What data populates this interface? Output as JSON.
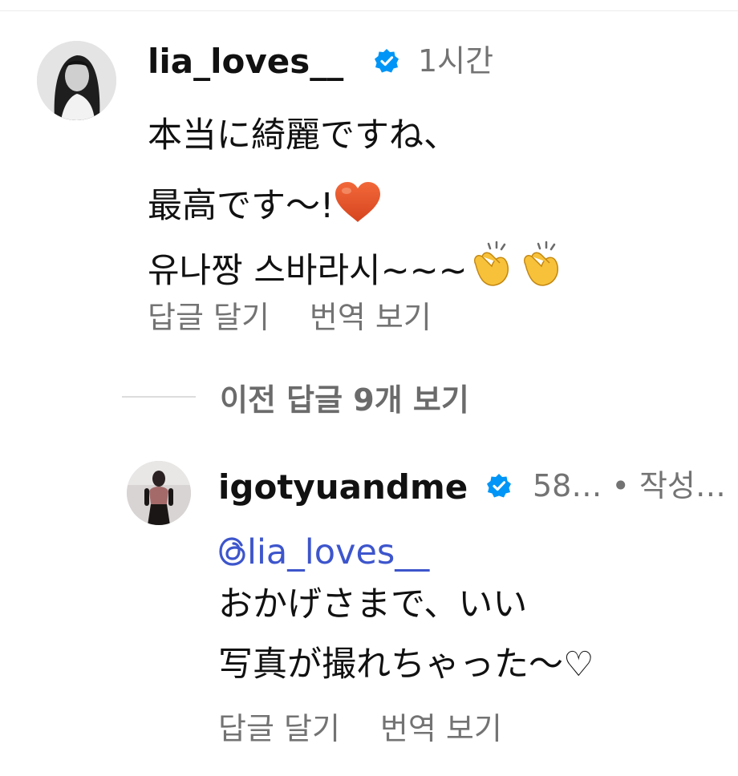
{
  "comments": [
    {
      "username": "lia_loves__",
      "verified": true,
      "time": "1시간",
      "lines": [
        "本当に綺麗ですね、",
        "最高です〜!",
        "유나짱 스바라시~~~"
      ],
      "emojis": {
        "heart": "heart-icon",
        "clap": "clapping-hands-icon"
      },
      "actions": {
        "reply": "답글 달기",
        "translate": "번역 보기"
      }
    },
    {
      "username": "igotyuandme",
      "verified": true,
      "time": "58…",
      "author_label": "• 작성…",
      "mention": "lia_loves__",
      "lines": [
        "おかげさまで、いい",
        "写真が撮れちゃった〜♡"
      ],
      "actions": {
        "reply": "답글 달기",
        "translate": "번역 보기"
      }
    }
  ],
  "replies_toggle": {
    "label": "이전 답글 9개 보기"
  },
  "colors": {
    "text": "#111111",
    "secondary": "#737373",
    "verified": "#0095f6",
    "mention": "#3d55cc"
  }
}
